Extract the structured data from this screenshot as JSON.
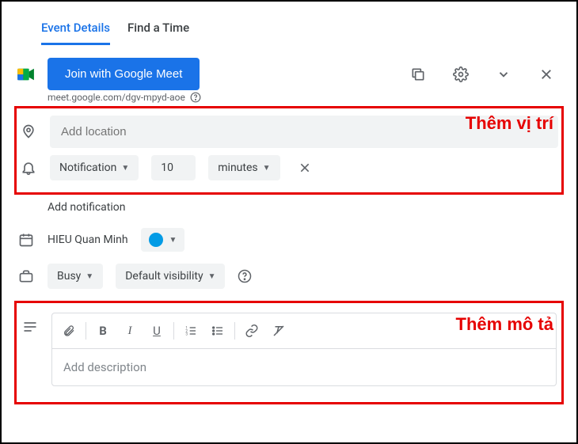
{
  "tabs": {
    "details": "Event Details",
    "findtime": "Find a Time"
  },
  "meet": {
    "button": "Join with Google Meet",
    "link": "meet.google.com/dgv-mpyd-aoe"
  },
  "location": {
    "placeholder": "Add location"
  },
  "notification": {
    "type": "Notification",
    "value": "10",
    "unit": "minutes"
  },
  "addNotification": "Add notification",
  "calendar": {
    "owner": "HIEU Quan Minh"
  },
  "availability": {
    "status": "Busy",
    "visibility": "Default visibility"
  },
  "description": {
    "placeholder": "Add description"
  },
  "annotations": {
    "location": "Thêm vị trí",
    "description": "Thêm mô tả"
  }
}
